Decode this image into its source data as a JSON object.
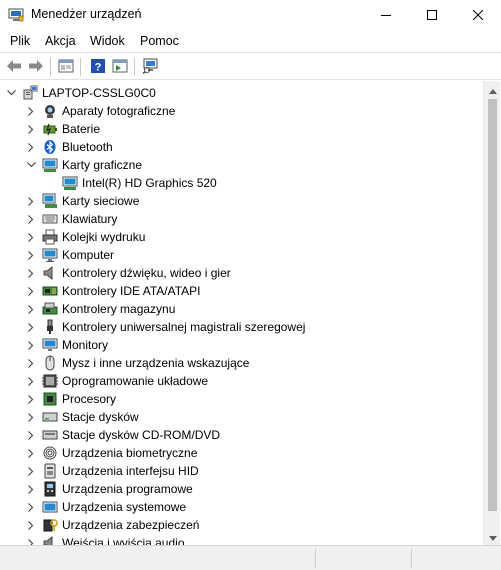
{
  "window": {
    "title": "Menedżer urządzeń",
    "icon": "device-manager-icon"
  },
  "menu": [
    "Plik",
    "Akcja",
    "Widok",
    "Pomoc"
  ],
  "toolbar": [
    "back-arrow-icon",
    "forward-arrow-icon",
    "properties-icon",
    "help-icon",
    "show-hidden-icon",
    "scan-hardware-icon"
  ],
  "tree": {
    "root": {
      "label": "LAPTOP-CSSLG0C0",
      "icon": "computer-root-icon",
      "expanded": true
    },
    "items": [
      {
        "label": "Aparaty fotograficzne",
        "icon": "camera-icon",
        "expanded": false
      },
      {
        "label": "Baterie",
        "icon": "battery-icon",
        "expanded": false
      },
      {
        "label": "Bluetooth",
        "icon": "bluetooth-icon",
        "expanded": false
      },
      {
        "label": "Karty graficzne",
        "icon": "display-adapter-icon",
        "expanded": true,
        "children": [
          {
            "label": "Intel(R) HD Graphics 520",
            "icon": "display-adapter-icon"
          }
        ]
      },
      {
        "label": "Karty sieciowe",
        "icon": "network-adapter-icon",
        "expanded": false
      },
      {
        "label": "Klawiatury",
        "icon": "keyboard-icon",
        "expanded": false
      },
      {
        "label": "Kolejki wydruku",
        "icon": "printer-icon",
        "expanded": false
      },
      {
        "label": "Komputer",
        "icon": "computer-icon",
        "expanded": false
      },
      {
        "label": "Kontrolery dźwięku, wideo i gier",
        "icon": "speaker-icon",
        "expanded": false
      },
      {
        "label": "Kontrolery IDE ATA/ATAPI",
        "icon": "ide-controller-icon",
        "expanded": false
      },
      {
        "label": "Kontrolery magazynu",
        "icon": "storage-controller-icon",
        "expanded": false
      },
      {
        "label": "Kontrolery uniwersalnej magistrali szeregowej",
        "icon": "usb-icon",
        "expanded": false
      },
      {
        "label": "Monitory",
        "icon": "monitor-icon",
        "expanded": false
      },
      {
        "label": "Mysz i inne urządzenia wskazujące",
        "icon": "mouse-icon",
        "expanded": false
      },
      {
        "label": "Oprogramowanie układowe",
        "icon": "firmware-icon",
        "expanded": false
      },
      {
        "label": "Procesory",
        "icon": "processor-icon",
        "expanded": false
      },
      {
        "label": "Stacje dysków",
        "icon": "disk-drive-icon",
        "expanded": false
      },
      {
        "label": "Stacje dysków CD-ROM/DVD",
        "icon": "cdrom-icon",
        "expanded": false
      },
      {
        "label": "Urządzenia biometryczne",
        "icon": "fingerprint-icon",
        "expanded": false
      },
      {
        "label": "Urządzenia interfejsu HID",
        "icon": "hid-icon",
        "expanded": false
      },
      {
        "label": "Urządzenia programowe",
        "icon": "software-device-icon",
        "expanded": false
      },
      {
        "label": "Urządzenia systemowe",
        "icon": "system-device-icon",
        "expanded": false
      },
      {
        "label": "Urządzenia zabezpieczeń",
        "icon": "security-device-icon",
        "expanded": false
      },
      {
        "label": "Wejścia i wyjścia audio",
        "icon": "audio-io-icon",
        "expanded": false
      }
    ]
  },
  "colors": {
    "accent": "#0078d7",
    "selection": "#cce8ff"
  }
}
